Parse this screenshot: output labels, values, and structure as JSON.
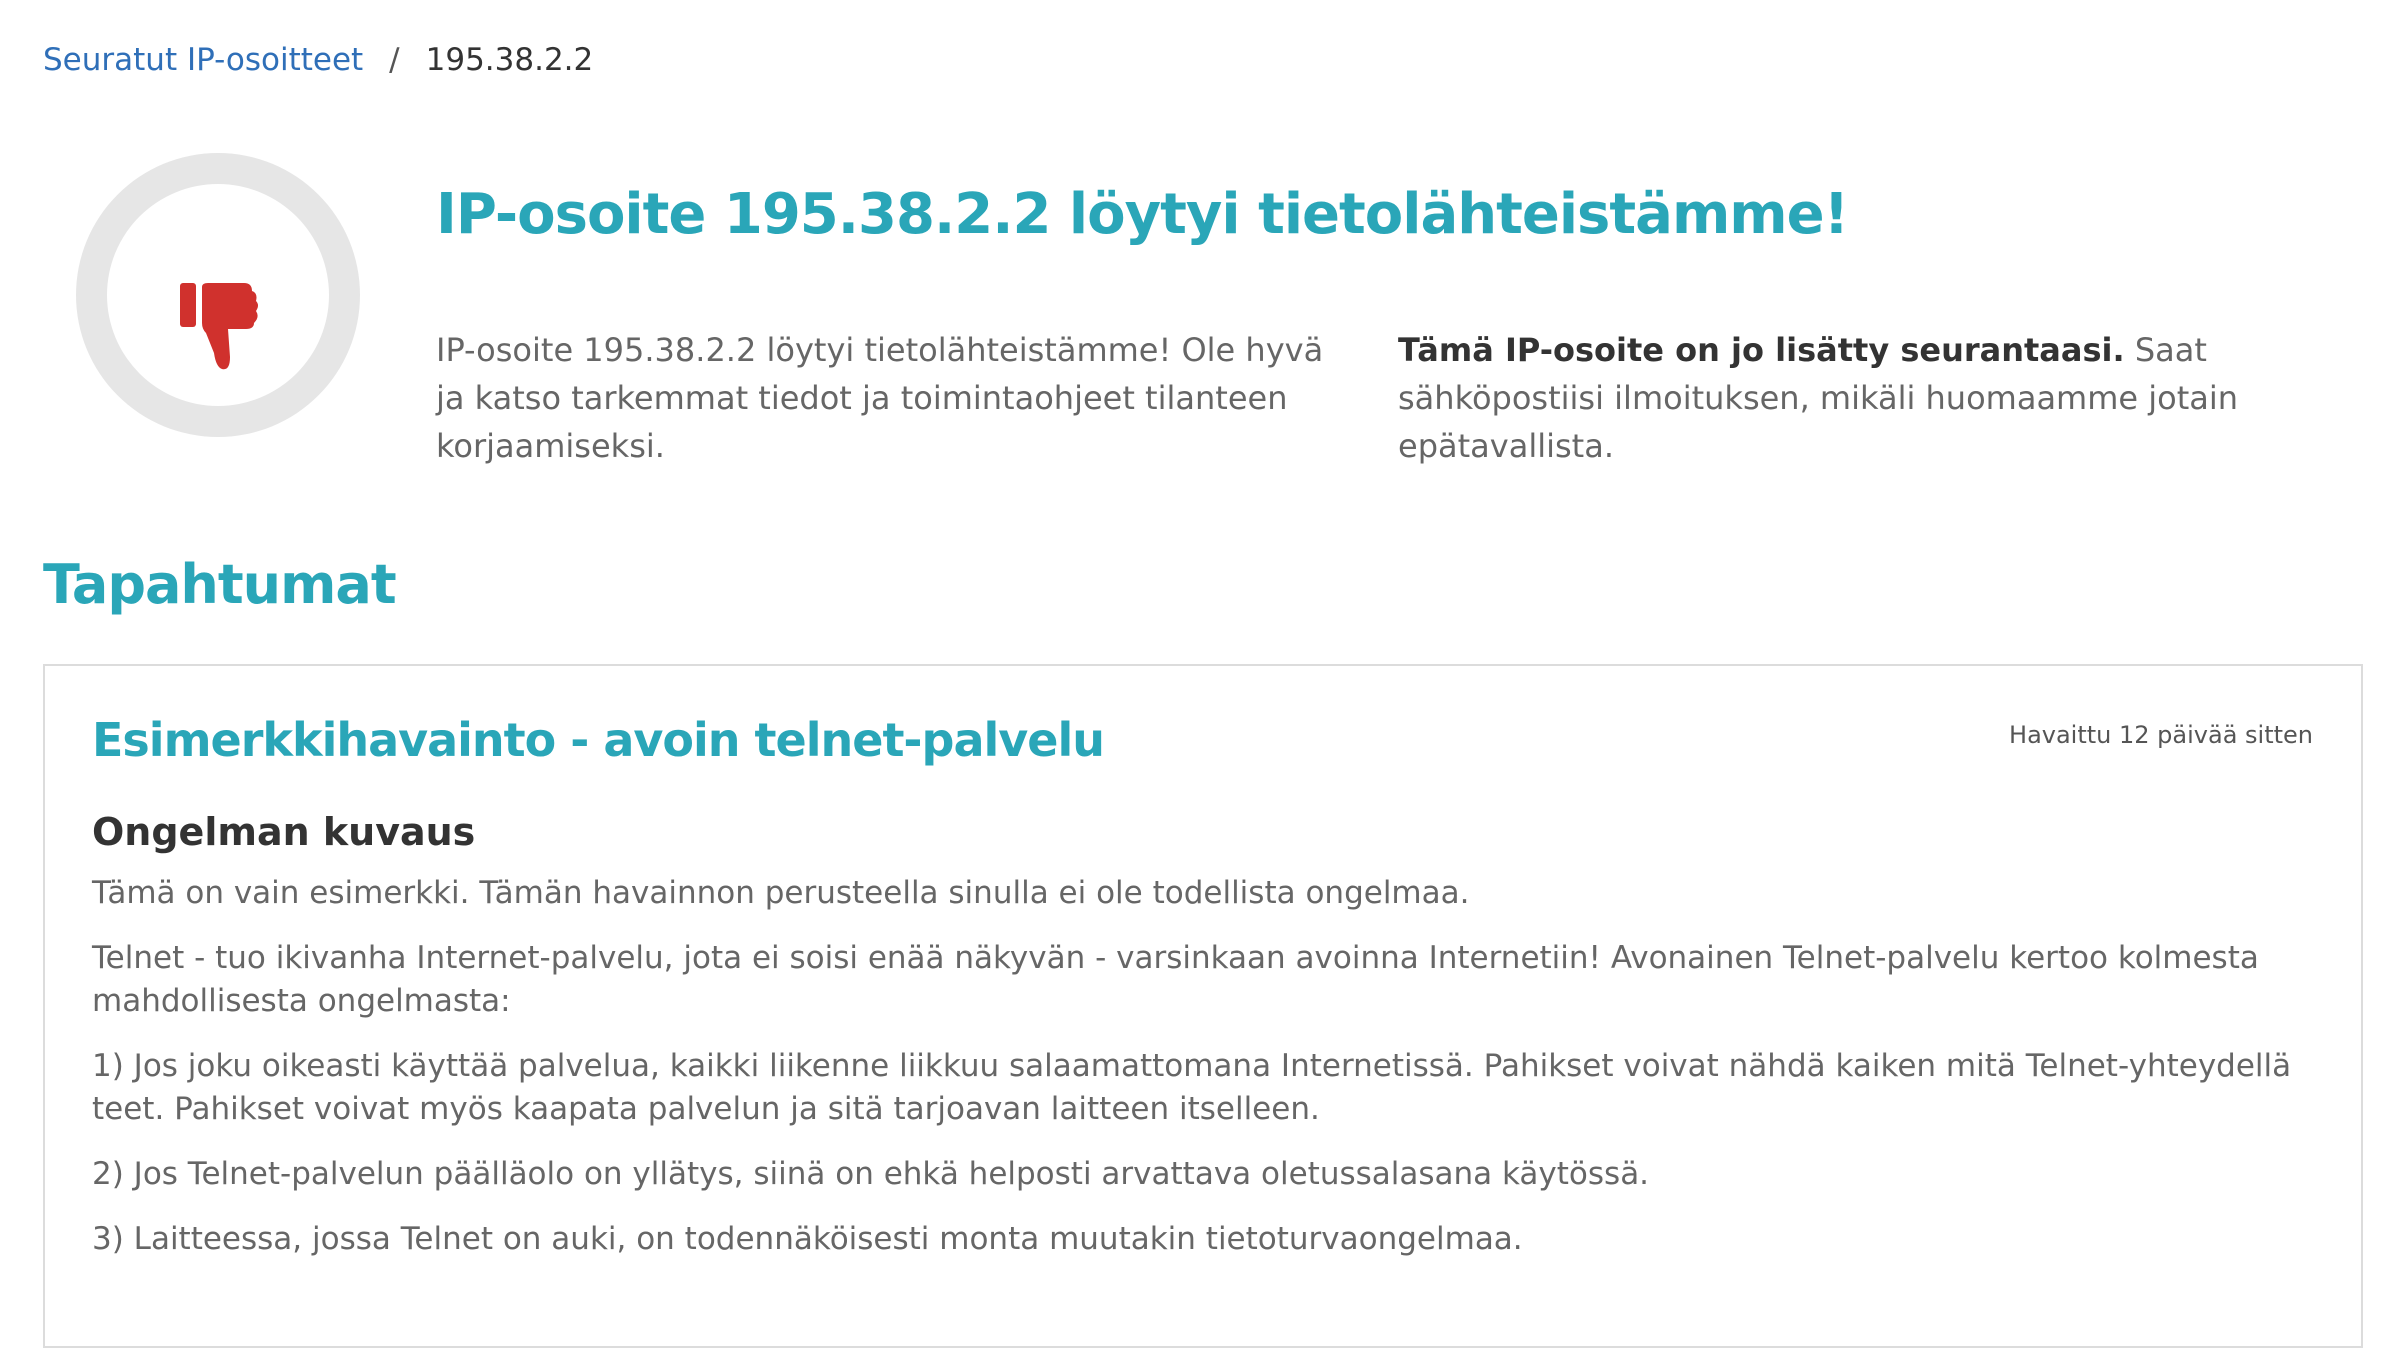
{
  "breadcrumb": {
    "parent_label": "Seuratut IP-osoitteet",
    "separator": "/",
    "current": "195.38.2.2"
  },
  "status": {
    "icon": "thumbs-down-icon",
    "icon_color": "#d0312d"
  },
  "hero": {
    "title": "IP-osoite 195.38.2.2 löytyi tietolähteistämme!",
    "left_text": "IP-osoite 195.38.2.2 löytyi tietolähteistämme! Ole hyvä ja katso tarkemmat tiedot ja toimintaohjeet tilanteen korjaamiseksi.",
    "right_bold": "Tämä IP-osoite on jo lisätty seurantaasi.",
    "right_text": " Saat sähköpostiisi ilmoituksen, mikäli huomaamme jotain epätavallista."
  },
  "events": {
    "section_title": "Tapahtumat",
    "items": [
      {
        "title": "Esimerkkihavainto - avoin telnet-palvelu",
        "timestamp": "Havaittu 12 päivää sitten",
        "subtitle": "Ongelman kuvaus",
        "paragraphs": [
          "Tämä on vain esimerkki. Tämän havainnon perusteella sinulla ei ole todellista ongelmaa.",
          "Telnet - tuo ikivanha Internet-palvelu, jota ei soisi enää näkyvän - varsinkaan avoinna Internetiin! Avonainen Telnet-palvelu kertoo kolmesta mahdollisesta ongelmasta:",
          "1) Jos joku oikeasti käyttää palvelua, kaikki liikenne liikkuu salaamattomana Internetissä. Pahikset voivat nähdä kaiken mitä Telnet-yhteydellä teet. Pahikset voivat myös kaapata palvelun ja sitä tarjoavan laitteen itselleen.",
          "2) Jos Telnet-palvelun päälläolo on yllätys, siinä on ehkä helposti arvattava oletussalasana käytössä.",
          "3) Laitteessa, jossa Telnet on auki, on todennäköisesti monta muutakin tietoturvaongelmaa."
        ]
      }
    ]
  },
  "colors": {
    "accent": "#2aa6b8",
    "link": "#2f6fb8",
    "danger": "#d0312d"
  }
}
